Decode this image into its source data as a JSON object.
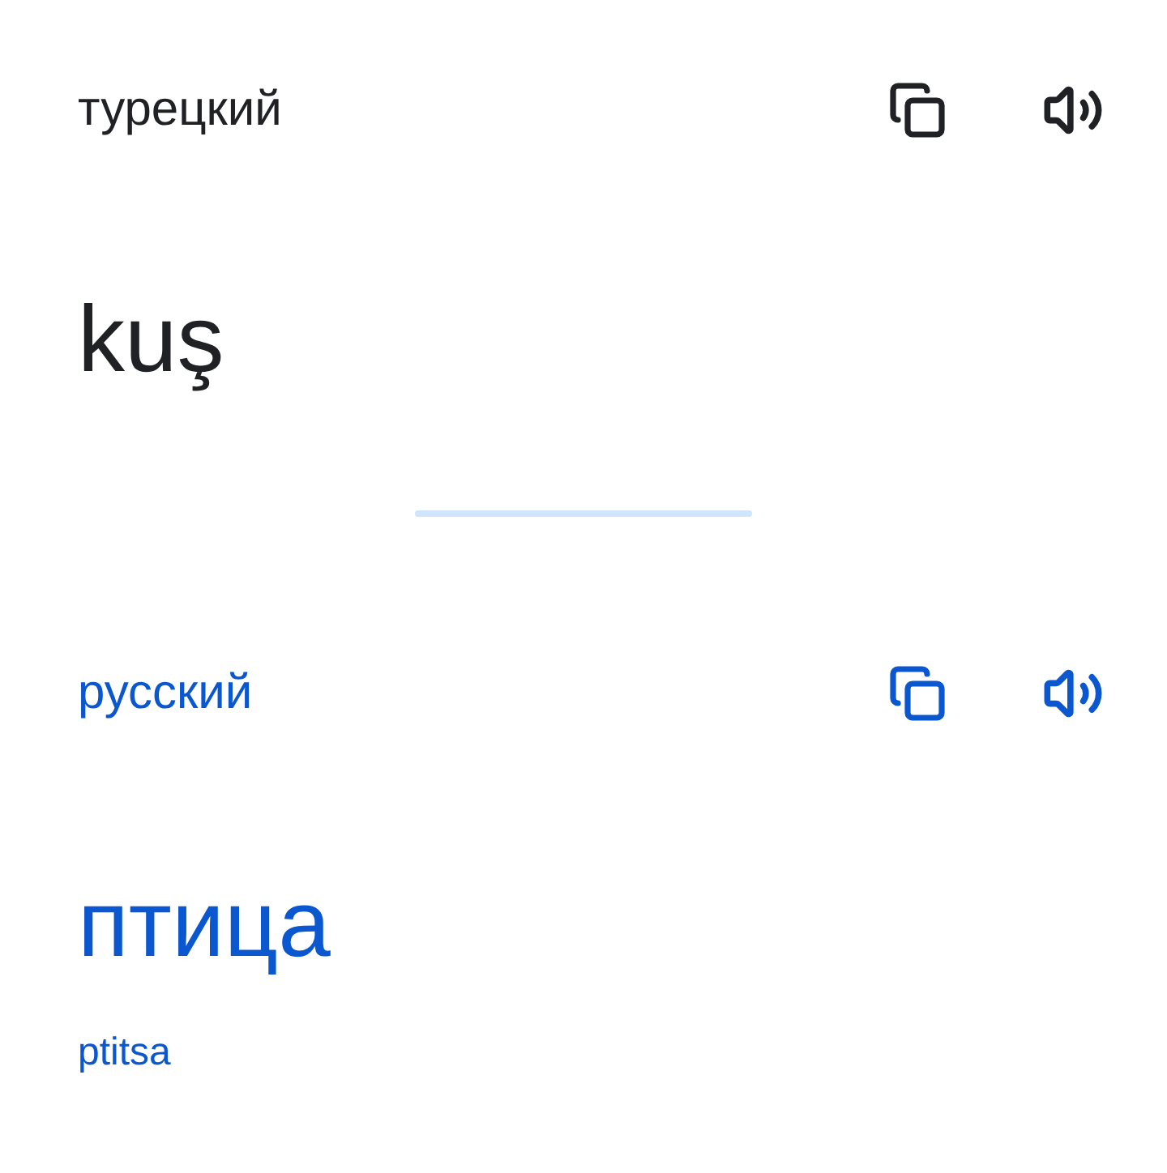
{
  "source": {
    "language": "турецкий",
    "text": "kuş"
  },
  "target": {
    "language": "русский",
    "text": "птица",
    "transliteration": "ptitsa"
  }
}
